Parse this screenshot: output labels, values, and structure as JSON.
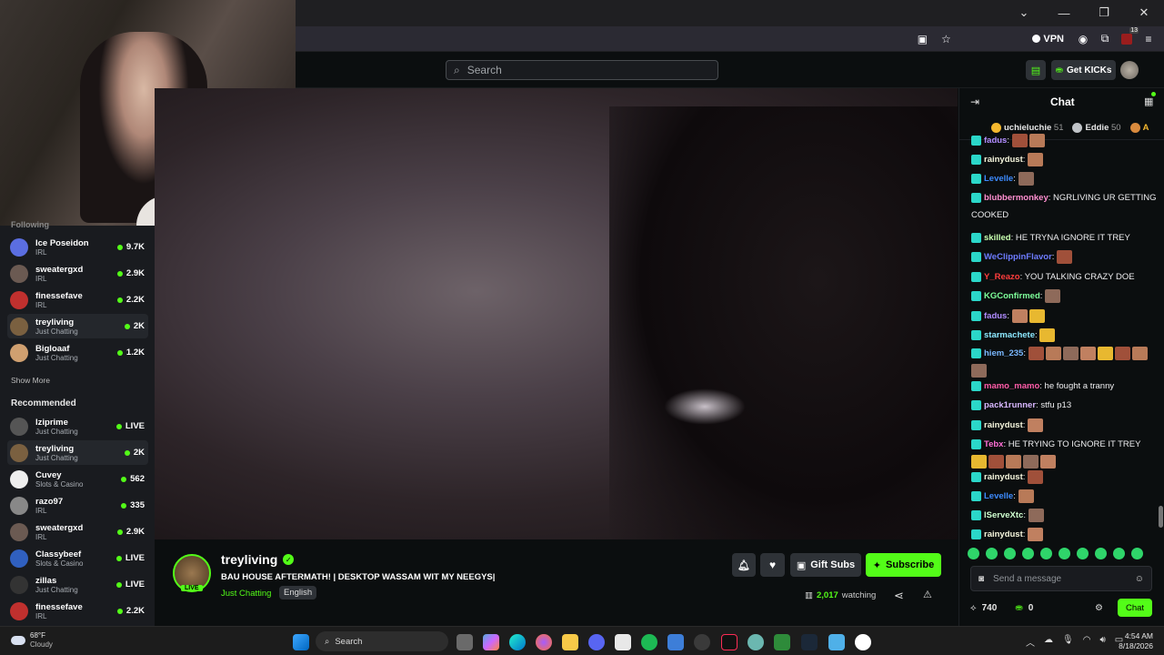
{
  "browser": {
    "vpn_label": "VPN",
    "ext_badge": "13"
  },
  "header": {
    "search_placeholder": "Search",
    "get_kicks_label": "Get KICKs"
  },
  "sidebar": {
    "following_heading": "Following",
    "following": [
      {
        "name": "Ice Poseidon",
        "category": "IRL",
        "viewers": "9.7K",
        "color": "#5b6ee1"
      },
      {
        "name": "sweatergxd",
        "category": "IRL",
        "viewers": "2.9K",
        "color": "#6b5a52"
      },
      {
        "name": "finessefave",
        "category": "IRL",
        "viewers": "2.2K",
        "color": "#c0302e"
      },
      {
        "name": "treyliving",
        "category": "Just Chatting",
        "viewers": "2K",
        "color": "#7a6040"
      },
      {
        "name": "Bigloaaf",
        "category": "Just Chatting",
        "viewers": "1.2K",
        "color": "#d0a070"
      }
    ],
    "show_more_label": "Show More",
    "recommended_heading": "Recommended",
    "recommended": [
      {
        "name": "lziprime",
        "category": "Just Chatting",
        "viewers": "LIVE",
        "color": "#555"
      },
      {
        "name": "treyliving",
        "category": "Just Chatting",
        "viewers": "2K",
        "color": "#7a6040"
      },
      {
        "name": "Cuvey",
        "category": "Slots & Casino",
        "viewers": "562",
        "color": "#eeeeee"
      },
      {
        "name": "razo97",
        "category": "IRL",
        "viewers": "335",
        "color": "#888"
      },
      {
        "name": "sweatergxd",
        "category": "IRL",
        "viewers": "2.9K",
        "color": "#6b5a52"
      },
      {
        "name": "Classybeef",
        "category": "Slots & Casino",
        "viewers": "LIVE",
        "color": "#3060c0"
      },
      {
        "name": "zillas",
        "category": "Just Chatting",
        "viewers": "LIVE",
        "color": "#333"
      },
      {
        "name": "finessefave",
        "category": "IRL",
        "viewers": "2.2K",
        "color": "#c0302e"
      }
    ]
  },
  "stream": {
    "streamer": "treyliving",
    "live_badge": "LIVE",
    "title": "BAU HOUSE AFTERMATH! | DESKTOP WASSAM WIT MY NEEGYS|",
    "category": "Just Chatting",
    "language": "English",
    "gift_subs_label": "Gift Subs",
    "subscribe_label": "Subscribe",
    "viewer_count": "2,017",
    "watching_label": "watching"
  },
  "chat": {
    "title": "Chat",
    "top_gifters": [
      {
        "rank": "1",
        "name": "uchieluchie",
        "count": "51",
        "color": "#f5b82e"
      },
      {
        "rank": "2",
        "name": "Eddie",
        "count": "50",
        "color": "#c0c4c8"
      },
      {
        "rank": "3",
        "name": "A",
        "count": "",
        "color": "#d98a3d"
      }
    ],
    "messages": [
      {
        "user": "fadus",
        "color": "#b08cff",
        "text": "",
        "emotes": 2
      },
      {
        "user": "rainydust",
        "color": "#f5f5dc",
        "text": "",
        "emotes": 1
      },
      {
        "user": "Levelle",
        "color": "#3d8bff",
        "text": "",
        "emotes": 1
      },
      {
        "user": "blubbermonkey",
        "color": "#ff8fd0",
        "text": "NGRLIVING UR GETTING COOKED",
        "emotes": 0
      },
      {
        "user": "skilled",
        "color": "#c8ffb0",
        "text": "HE TRYNA IGNORE IT TREY",
        "emotes": 0
      },
      {
        "user": "WeClippinFlavor",
        "color": "#6e7cff",
        "text": "",
        "emotes": 1
      },
      {
        "user": "Y_Reazo",
        "color": "#ff3d3d",
        "text": "YOU TALKING CRAZY DOE",
        "emotes": 0
      },
      {
        "user": "KGConfirmed",
        "color": "#7dff9a",
        "text": "",
        "emotes": 1
      },
      {
        "user": "fadus",
        "color": "#b08cff",
        "text": "",
        "emotes": 2
      },
      {
        "user": "starmachete",
        "color": "#8ce8ff",
        "text": "",
        "emotes": 1
      },
      {
        "user": "hiem_235",
        "color": "#7ab8ff",
        "text": "",
        "emotes": 8
      },
      {
        "user": "mamo_mamo",
        "color": "#ff5ca8",
        "text": "he fought a tranny",
        "emotes": 0
      },
      {
        "user": "pack1runner",
        "color": "#d9b8ff",
        "text": "stfu p13",
        "emotes": 0
      },
      {
        "user": "rainydust",
        "color": "#f5f5dc",
        "text": "",
        "emotes": 1
      },
      {
        "user": "Tebx",
        "color": "#ff6fd6",
        "text": "HE TRYING TO IGNORE IT TREY",
        "emotes": 5
      },
      {
        "user": "rainydust",
        "color": "#f5f5dc",
        "text": "",
        "emotes": 1
      },
      {
        "user": "Levelle",
        "color": "#3d8bff",
        "text": "",
        "emotes": 1
      },
      {
        "user": "lServeXtc",
        "color": "#d0ffd0",
        "text": "",
        "emotes": 1
      },
      {
        "user": "rainydust",
        "color": "#f5f5dc",
        "text": "",
        "emotes": 1
      }
    ],
    "input_placeholder": "Send a message",
    "points": "740",
    "kicks": "0",
    "chat_button_label": "Chat"
  },
  "taskbar": {
    "weather_temp": "68°F",
    "weather_desc": "Cloudy",
    "search_label": "Search",
    "time": "4:54 AM",
    "date": "8/18/2026"
  },
  "colors": {
    "accent": "#53fc18",
    "bg": "#0b0e0f",
    "panel": "#191b1f"
  }
}
